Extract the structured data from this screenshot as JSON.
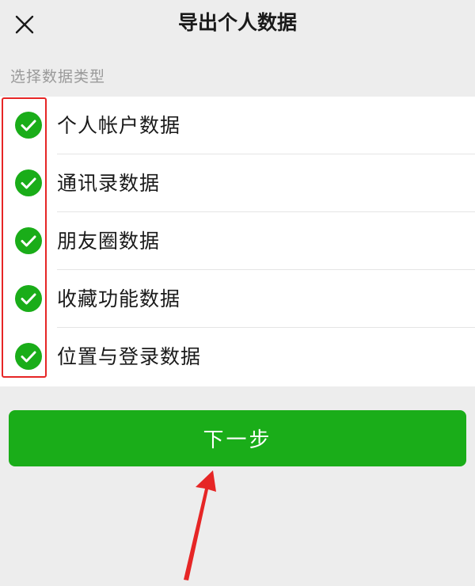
{
  "header": {
    "title": "导出个人数据",
    "close_icon": "close-icon"
  },
  "section": {
    "label": "选择数据类型"
  },
  "options": [
    {
      "label": "个人帐户数据",
      "checked": true
    },
    {
      "label": "通讯录数据",
      "checked": true
    },
    {
      "label": "朋友圈数据",
      "checked": true
    },
    {
      "label": "收藏功能数据",
      "checked": true
    },
    {
      "label": "位置与登录数据",
      "checked": true
    }
  ],
  "next_button": {
    "label": "下一步"
  },
  "colors": {
    "accent_green": "#1aad19",
    "annotation_red": "#e62626",
    "background": "#ededed"
  }
}
